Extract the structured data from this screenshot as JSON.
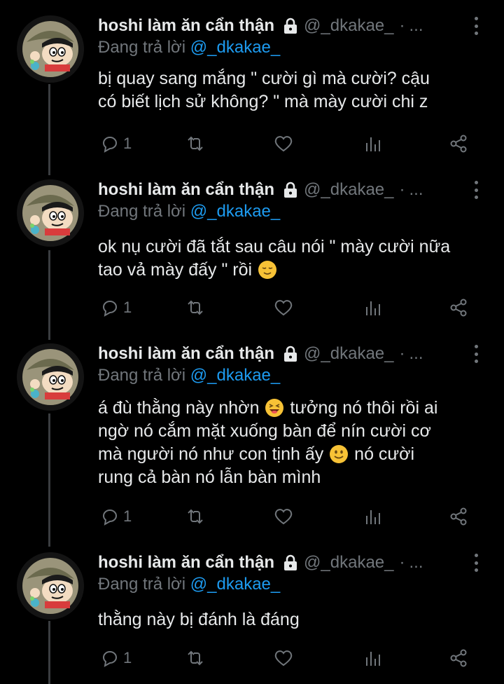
{
  "colors": {
    "background": "#000000",
    "text": "#e7e9ea",
    "muted": "#71767b",
    "link": "#1d9bf0",
    "thread_line": "#3a3d40"
  },
  "tweets": [
    {
      "name": "hoshi làm ăn cẩn thận",
      "handle": "@_dkakae_",
      "separator": "·",
      "time": "...",
      "replying_prefix": "Đang trả lời",
      "replying_to": "@_dkakae_",
      "lines": [
        "bị quay sang mắng \" cười gì mà cười? cậu",
        "có biết lịch sử không? \" mà mày cười chi z"
      ],
      "reply_count": "1"
    },
    {
      "name": "hoshi làm ăn cẩn thận",
      "handle": "@_dkakae_",
      "separator": "·",
      "time": "...",
      "replying_prefix": "Đang trả lời",
      "replying_to": "@_dkakae_",
      "lines": [
        "ok nụ cười đã tắt sau câu nói \" mày cười nữa",
        "tao vả mày đấy \" rồi"
      ],
      "reply_count": "1"
    },
    {
      "name": "hoshi làm ăn cẩn thận",
      "handle": "@_dkakae_",
      "separator": "·",
      "time": "...",
      "replying_prefix": "Đang trả lời",
      "replying_to": "@_dkakae_",
      "lines": [
        "á đù thằng này nhờn",
        "tưởng nó thôi rồi ai",
        "ngờ nó cắm mặt xuống bàn để nín cười cơ",
        "mà người nó như con tịnh ấy",
        "nó cười",
        "rung cả bàn nó lẫn bàn mình"
      ],
      "reply_count": "1"
    },
    {
      "name": "hoshi làm ăn cẩn thận",
      "handle": "@_dkakae_",
      "separator": "·",
      "time": "...",
      "replying_prefix": "Đang trả lời",
      "replying_to": "@_dkakae_",
      "lines": [
        "thằng này bị đánh là đáng"
      ],
      "reply_count": "1"
    }
  ],
  "icons": {
    "lock": "lock-icon",
    "more": "more-icon",
    "reply": "reply-icon",
    "retweet": "retweet-icon",
    "like": "heart-icon",
    "views": "views-icon",
    "share": "share-icon",
    "emoji_relieved": "relieved-face-emoji",
    "emoji_grin": "grinning-squinting-emoji",
    "emoji_smile": "slightly-smiling-emoji"
  }
}
